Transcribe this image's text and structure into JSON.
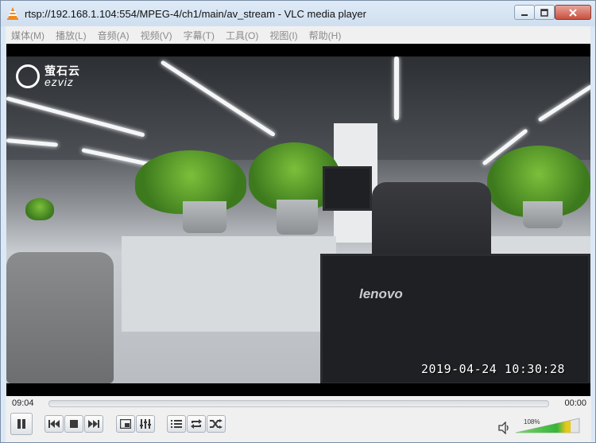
{
  "window": {
    "title": "rtsp://192.168.1.104:554/MPEG-4/ch1/main/av_stream - VLC media player"
  },
  "menu": [
    "媒体(M)",
    "播放(L)",
    "音频(A)",
    "视频(V)",
    "字幕(T)",
    "工具(O)",
    "视图(I)",
    "帮助(H)"
  ],
  "video": {
    "logo_cn": "萤石云",
    "logo_en": "ezviz",
    "osd_timestamp": "2019-04-24 10:30:28",
    "monitor_brand": "lenovo"
  },
  "playback": {
    "elapsed": "09:04",
    "total": "00:00",
    "progress_fraction": 0
  },
  "volume": {
    "label": "108%",
    "level_percent": 108
  },
  "icons": {
    "pause": "pause-icon",
    "previous": "previous-icon",
    "stop": "stop-icon",
    "next": "next-icon",
    "fullscreen": "fullscreen-icon",
    "extended_settings": "equalizer-icon",
    "playlist": "playlist-icon",
    "loop": "loop-icon",
    "shuffle": "shuffle-icon",
    "volume": "speaker-icon"
  },
  "colors": {
    "vlc_orange": "#f08a1c",
    "volume_green": "#36b43a"
  }
}
